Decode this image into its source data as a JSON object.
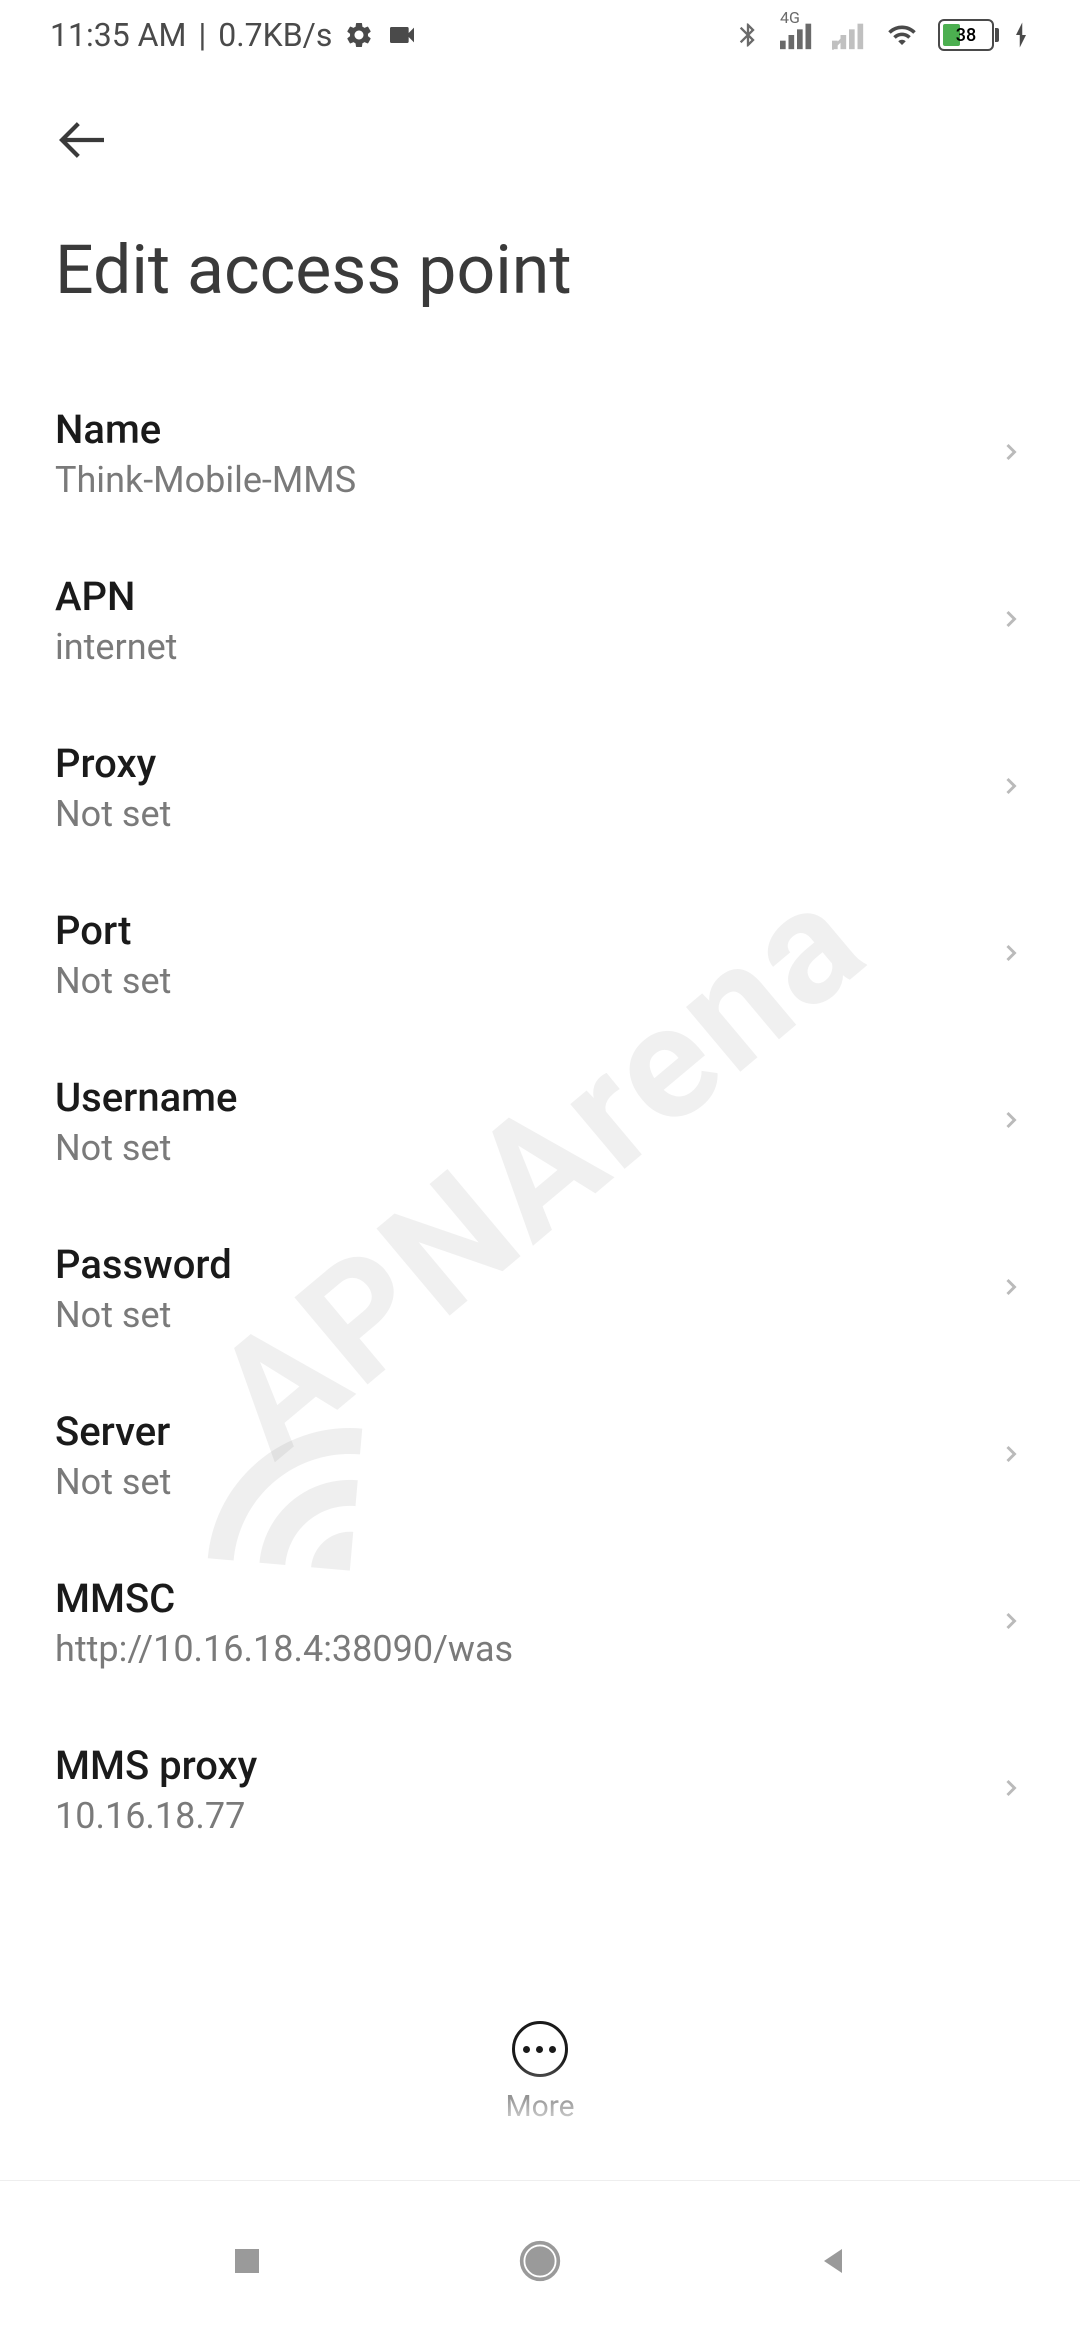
{
  "statusbar": {
    "time": "11:35 AM",
    "data_rate": "0.7KB/s",
    "network_label": "4G",
    "battery_percent": "38"
  },
  "header": {
    "title": "Edit access point"
  },
  "settings": {
    "items": [
      {
        "label": "Name",
        "value": "Think-Mobile-MMS"
      },
      {
        "label": "APN",
        "value": "internet"
      },
      {
        "label": "Proxy",
        "value": "Not set"
      },
      {
        "label": "Port",
        "value": "Not set"
      },
      {
        "label": "Username",
        "value": "Not set"
      },
      {
        "label": "Password",
        "value": "Not set"
      },
      {
        "label": "Server",
        "value": "Not set"
      },
      {
        "label": "MMSC",
        "value": "http://10.16.18.4:38090/was"
      },
      {
        "label": "MMS proxy",
        "value": "10.16.18.77"
      }
    ]
  },
  "bottom": {
    "more_label": "More"
  },
  "watermark": {
    "text": "APNArena"
  }
}
